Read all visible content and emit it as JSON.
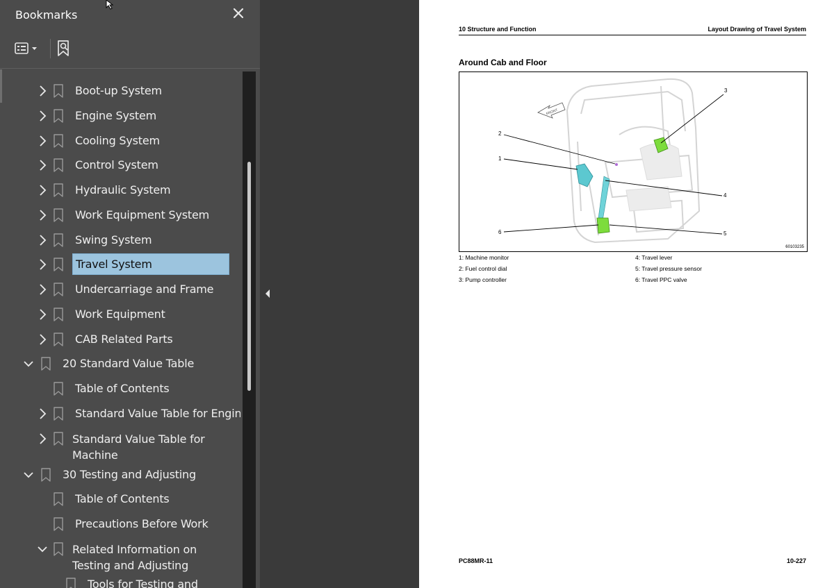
{
  "panel": {
    "title": "Bookmarks",
    "close_icon": "close-icon",
    "options_icon": "bookmark-options-icon",
    "find_icon": "find-current-bookmark-icon",
    "colors": {
      "background": "#4b4b4b",
      "selected": "#9cc4de",
      "text": "#efefef"
    }
  },
  "tree": [
    {
      "label": "Boot-up System",
      "expander": "collapsed",
      "selected": false
    },
    {
      "label": "Engine System",
      "expander": "collapsed",
      "selected": false
    },
    {
      "label": "Cooling System",
      "expander": "collapsed",
      "selected": false
    },
    {
      "label": "Control System",
      "expander": "collapsed",
      "selected": false
    },
    {
      "label": "Hydraulic System",
      "expander": "collapsed",
      "selected": false
    },
    {
      "label": "Work Equipment System",
      "expander": "collapsed",
      "selected": false
    },
    {
      "label": "Swing System",
      "expander": "collapsed",
      "selected": false
    },
    {
      "label": "Travel System",
      "expander": "collapsed",
      "selected": true
    },
    {
      "label": "Undercarriage and Frame",
      "expander": "collapsed",
      "selected": false
    },
    {
      "label": "Work Equipment",
      "expander": "collapsed",
      "selected": false
    },
    {
      "label": "CAB Related Parts",
      "expander": "collapsed",
      "selected": false
    },
    {
      "label": "20 Standard Value Table",
      "expander": "expanded",
      "selected": false
    },
    {
      "label": "Table of Contents",
      "expander": "none",
      "selected": false
    },
    {
      "label": "Standard Value Table for Engine",
      "expander": "collapsed",
      "selected": false
    },
    {
      "label": "Standard Value Table for Machine",
      "expander": "collapsed",
      "selected": false
    },
    {
      "label": "30 Testing and Adjusting",
      "expander": "expanded",
      "selected": false
    },
    {
      "label": "Table of Contents",
      "expander": "none",
      "selected": false
    },
    {
      "label": "Precautions Before Work",
      "expander": "none",
      "selected": false
    },
    {
      "label": "Related Information on Testing and Adjusting",
      "expander": "expanded",
      "selected": false
    },
    {
      "label": "Tools for Testing and",
      "expander": "none",
      "selected": false
    }
  ],
  "document": {
    "header_left": "10 Structure and Function",
    "header_right": "Layout Drawing of Travel System",
    "section_title": "Around Cab and Floor",
    "figure": {
      "code": "60103235",
      "front_label": "FRONT",
      "callouts": [
        "1",
        "2",
        "3",
        "4",
        "5",
        "6"
      ]
    },
    "legend": [
      "1: Machine monitor",
      "2: Fuel control dial",
      "3: Pump controller",
      "4: Travel lever",
      "5: Travel pressure sensor",
      "6: Travel PPC valve"
    ],
    "footer_left": "PC88MR-11",
    "footer_right": "10-227"
  }
}
